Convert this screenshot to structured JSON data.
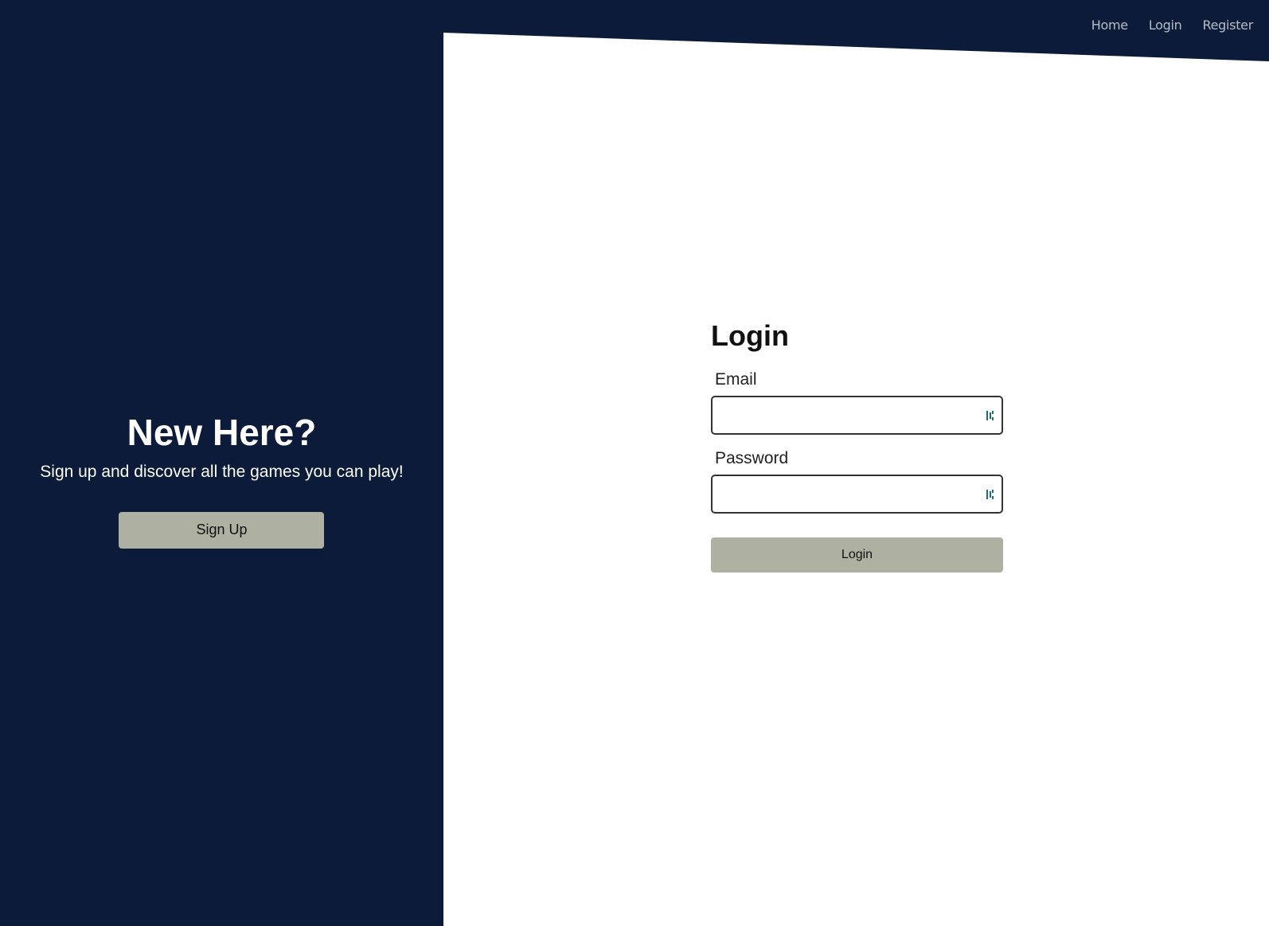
{
  "nav": {
    "home": "Home",
    "login": "Login",
    "register": "Register"
  },
  "left": {
    "title": "New Here?",
    "subtitle": "Sign up and discover all the games you can play!",
    "signup_label": "Sign Up"
  },
  "form": {
    "title": "Login",
    "email_label": "Email",
    "email_value": "",
    "password_label": "Password",
    "password_value": "",
    "submit_label": "Login"
  },
  "colors": {
    "background": "#0b1b39",
    "panel": "#ffffff",
    "button": "#aeb0a2",
    "icon": "#1b6b78"
  },
  "icons": {
    "field_icon": "password-manager-icon"
  }
}
